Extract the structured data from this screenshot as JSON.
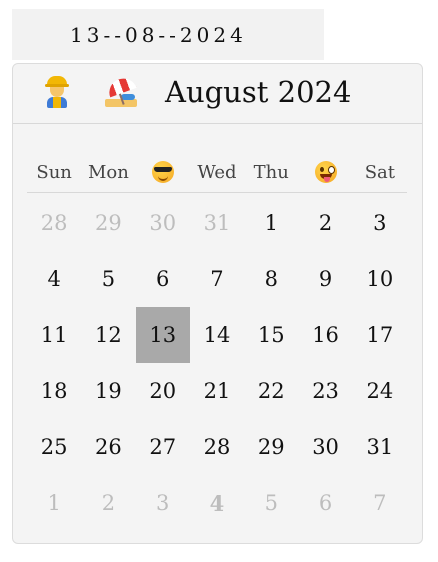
{
  "date_input": {
    "value": "13--08--2024"
  },
  "header": {
    "prev_icon": "construction-worker-icon",
    "next_icon": "beach-umbrella-icon",
    "month_title": "August 2024"
  },
  "weekdays": [
    {
      "label": "Sun"
    },
    {
      "label": "Mon"
    },
    {
      "label": "",
      "icon": "cool-face-icon"
    },
    {
      "label": "Wed"
    },
    {
      "label": "Thu"
    },
    {
      "label": "",
      "icon": "tongue-face-icon"
    },
    {
      "label": "Sat"
    }
  ],
  "days": [
    {
      "label": "28",
      "outside": true
    },
    {
      "label": "29",
      "outside": true
    },
    {
      "label": "30",
      "outside": true
    },
    {
      "label": "31",
      "outside": true
    },
    {
      "label": "1"
    },
    {
      "label": "2"
    },
    {
      "label": "3"
    },
    {
      "label": "4"
    },
    {
      "label": "5"
    },
    {
      "label": "6"
    },
    {
      "label": "7"
    },
    {
      "label": "8"
    },
    {
      "label": "9"
    },
    {
      "label": "10"
    },
    {
      "label": "11"
    },
    {
      "label": "12"
    },
    {
      "label": "13",
      "selected": true
    },
    {
      "label": "14"
    },
    {
      "label": "15"
    },
    {
      "label": "16"
    },
    {
      "label": "17"
    },
    {
      "label": "18"
    },
    {
      "label": "19"
    },
    {
      "label": "20"
    },
    {
      "label": "21"
    },
    {
      "label": "22"
    },
    {
      "label": "23"
    },
    {
      "label": "24"
    },
    {
      "label": "25"
    },
    {
      "label": "26"
    },
    {
      "label": "27"
    },
    {
      "label": "28"
    },
    {
      "label": "29"
    },
    {
      "label": "30"
    },
    {
      "label": "31"
    },
    {
      "label": "1",
      "outside": true
    },
    {
      "label": "2",
      "outside": true
    },
    {
      "label": "3",
      "outside": true
    },
    {
      "label": "4",
      "outside": true,
      "bold": true
    },
    {
      "label": "5",
      "outside": true
    },
    {
      "label": "6",
      "outside": true
    },
    {
      "label": "7",
      "outside": true
    }
  ],
  "colors": {
    "selected_bg": "#a9a9a9",
    "outside_text": "#bdbdbd",
    "calendar_bg": "#f4f4f4",
    "input_bg": "#f2f2f2"
  }
}
